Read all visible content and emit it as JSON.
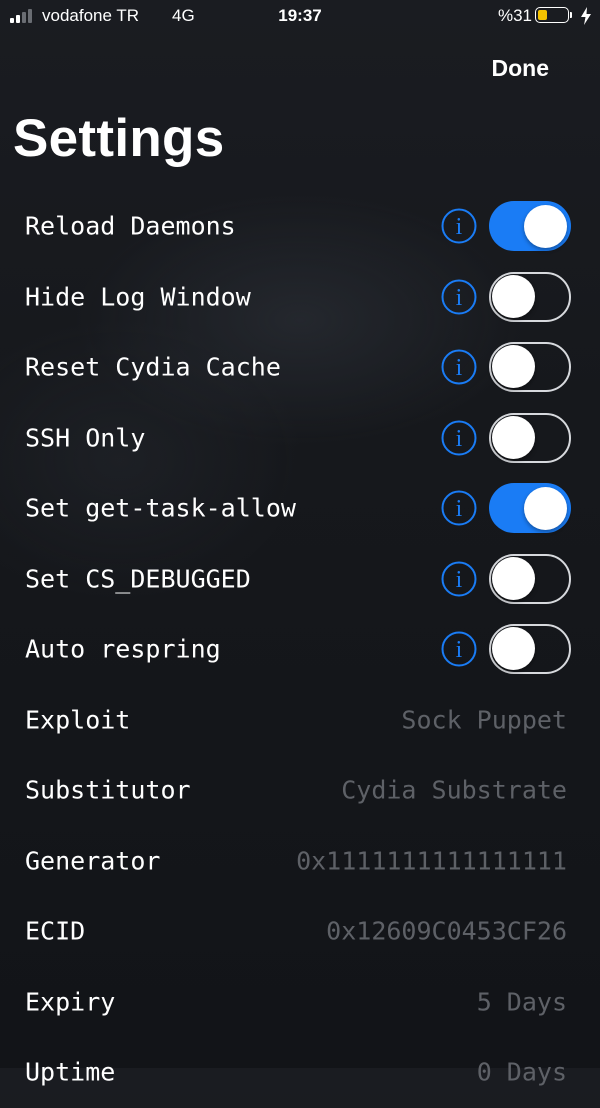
{
  "status_bar": {
    "carrier": "vodafone TR",
    "network": "4G",
    "time": "19:37",
    "battery_percent": "%31",
    "battery_level": 0.31,
    "battery_color": "#f5c300"
  },
  "nav": {
    "done_label": "Done"
  },
  "title": "Settings",
  "colors": {
    "accent": "#1a7cf5",
    "value_text": "#5e6167"
  },
  "toggles": [
    {
      "label": "Reload Daemons",
      "on": true
    },
    {
      "label": "Hide Log Window",
      "on": false
    },
    {
      "label": "Reset Cydia Cache",
      "on": false
    },
    {
      "label": "SSH Only",
      "on": false
    },
    {
      "label": "Set get-task-allow",
      "on": true
    },
    {
      "label": "Set CS_DEBUGGED",
      "on": false
    },
    {
      "label": "Auto respring",
      "on": false
    }
  ],
  "info_rows": [
    {
      "label": "Exploit",
      "value": "Sock Puppet"
    },
    {
      "label": "Substitutor",
      "value": "Cydia Substrate"
    },
    {
      "label": "Generator",
      "value": "0x1111111111111111"
    },
    {
      "label": "ECID",
      "value": "0x12609C0453CF26"
    },
    {
      "label": "Expiry",
      "value": "5 Days"
    },
    {
      "label": "Uptime",
      "value": "0 Days"
    }
  ]
}
